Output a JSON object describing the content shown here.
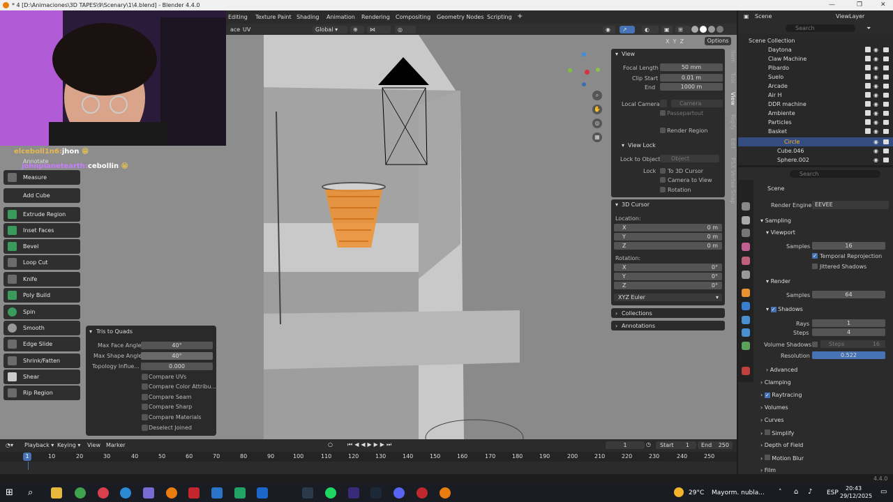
{
  "titlebar": {
    "title": "* 4 [D:\\Animaciones\\3D TAPES\\9\\Scenary\\1\\4.blend] - Blender 4.4.0",
    "min": "—",
    "max": "❐",
    "close": "✕"
  },
  "workspaces": [
    "Editing",
    "Texture Paint",
    "Shading",
    "Animation",
    "Rendering",
    "Compositing",
    "Geometry Nodes",
    "Scripting",
    "+"
  ],
  "viewport_header": {
    "mode_suffix": "ace",
    "uv": "UV",
    "orientation": "Global",
    "options": "Options",
    "axes": [
      "X",
      "Y",
      "Z"
    ]
  },
  "chat": [
    {
      "user": "elceboll1n6:",
      "msg": "jhon"
    },
    {
      "user": "johnplanetearth:",
      "msg": "cebollin"
    }
  ],
  "annotate_label": "Annotate",
  "tools": [
    "Measure",
    "Add Cube",
    "Extrude Region",
    "Inset Faces",
    "Bevel",
    "Loop Cut",
    "Knife",
    "Poly Build",
    "Spin",
    "Smooth",
    "Edge Slide",
    "Shrink/Fatten",
    "Shear",
    "Rip Region"
  ],
  "operator": {
    "title": "Tris to Quads",
    "fields": [
      {
        "label": "Max Face Angle",
        "value": "40°"
      },
      {
        "label": "Max Shape Angle",
        "value": "40°"
      },
      {
        "label": "Topology Influe...",
        "value": "0.000"
      }
    ],
    "checks": [
      "Compare UVs",
      "Compare Color Attribu...",
      "Compare Seam",
      "Compare Sharp",
      "Compare Materials",
      "Deselect Joined"
    ]
  },
  "npanel": {
    "view": {
      "title": "View",
      "focal_label": "Focal Length",
      "focal": "50 mm",
      "clip_start_label": "Clip Start",
      "clip_start": "0.01 m",
      "end_label": "End",
      "end": "1000 m",
      "local_camera_label": "Local Camera",
      "camera": "Camera",
      "passepartout": "Passepartout",
      "render_region": "Render Region"
    },
    "view_lock": {
      "title": "View Lock",
      "lock_obj_label": "Lock to Object",
      "object_ph": "Object",
      "lock_label": "Lock",
      "to_cursor": "To 3D Cursor",
      "cam_to_view": "Camera to View",
      "rotation": "Rotation"
    },
    "cursor": {
      "title": "3D Cursor",
      "location_label": "Location:",
      "loc": [
        {
          "axis": "X",
          "value": "0 m"
        },
        {
          "axis": "Y",
          "value": "0 m"
        },
        {
          "axis": "Z",
          "value": "0 m"
        }
      ],
      "rotation_label": "Rotation:",
      "rot": [
        {
          "axis": "X",
          "value": "0°"
        },
        {
          "axis": "Y",
          "value": "0°"
        },
        {
          "axis": "Z",
          "value": "0°"
        }
      ],
      "mode": "XYZ Euler"
    },
    "collections": "Collections",
    "annotations": "Annotations"
  },
  "ntabs": [
    "Item",
    "Tool",
    "View",
    "Rigify",
    "Edit",
    "PSX Vertex Snap"
  ],
  "outliner": {
    "scene": "Scene",
    "viewlayer": "ViewLayer",
    "search": "Search",
    "root": "Scene Collection",
    "items": [
      "Daytona",
      "Claw Machine",
      "Pibardo",
      "Suelo",
      "Arcade",
      "Air H",
      "DDR machine",
      "Ambiente",
      "Particles",
      "Basket",
      "Circle",
      "Cube.046",
      "Sphere.002"
    ]
  },
  "props": {
    "search": "Search",
    "scene": "Scene",
    "engine_label": "Render Engine",
    "engine": "EEVEE",
    "sampling": "Sampling",
    "viewport": "Viewport",
    "samples_label": "Samples",
    "vp_samples": "16",
    "temporal": "Temporal Reprojection",
    "jittered": "Jittered Shadows",
    "render": "Render",
    "render_samples": "64",
    "shadows": "Shadows",
    "rays_label": "Rays",
    "rays": "1",
    "steps_label": "Steps",
    "steps": "4",
    "vol_shadows": "Volume Shadows",
    "vol_steps_label": "Steps",
    "vol_steps": "16",
    "resolution_label": "Resolution",
    "resolution": "0.522",
    "advanced": "Advanced",
    "clamping": "Clamping",
    "raytracing": "Raytracing",
    "volumes": "Volumes",
    "curves": "Curves",
    "simplify": "Simplify",
    "dof": "Depth of Field",
    "motion_blur": "Motion Blur",
    "film": "Film"
  },
  "timeline": {
    "playback": "Playback",
    "keying": "Keying",
    "view": "View",
    "marker": "Marker",
    "frame": "1",
    "start_label": "Start",
    "start": "1",
    "end_label": "End",
    "end": "250",
    "current": "1",
    "ticks": [
      "10",
      "20",
      "30",
      "40",
      "50",
      "60",
      "70",
      "80",
      "90",
      "100",
      "110",
      "120",
      "130",
      "140",
      "150",
      "160",
      "170",
      "180",
      "190",
      "200",
      "210",
      "220",
      "230",
      "240",
      "250"
    ]
  },
  "version": "4.4.0",
  "taskbar": {
    "weather_temp": "29°C",
    "weather_text": "Mayorm. nubla...",
    "lang": "ESP",
    "time": "20:43",
    "date": "29/12/2025"
  }
}
